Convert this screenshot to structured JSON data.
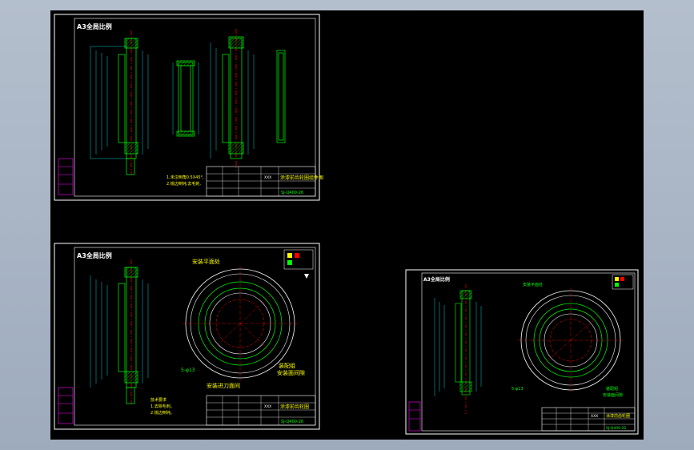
{
  "colors": {
    "background": "#000000",
    "frame": "#ffffff",
    "geometry": "#00ff00",
    "dimension": "#00ffff",
    "centerline": "#ff0000",
    "text": "#ffff00",
    "magenta": "#ff00ff"
  },
  "sheets": [
    {
      "title": "A3全局比例",
      "notes": [
        "1.未注倒角0.5X45°,",
        "2.锐边倒钝,去毛刺,"
      ],
      "title_block": {
        "name": "涂漆前齿轮圈组件图",
        "code": "SJ-Q400-26",
        "label": "XXX"
      }
    },
    {
      "title": "A3全局比例",
      "annotations": [
        "安装平面处",
        "5-φ13",
        "安装进刀面间",
        "装配组",
        "安装面间隙"
      ],
      "notes": [
        "技术要求",
        "1.去除毛刺。",
        "2.锐边倒钝。"
      ],
      "title_block": {
        "name": "涂漆前齿轮圈",
        "code": "SJ-Q400-26",
        "label": "XXX"
      }
    },
    {
      "title": "A3全局比例",
      "annotations": [
        "安装平面处",
        "5-φ13",
        "装配组",
        "安装面间隙"
      ],
      "title_block": {
        "name": "涂漆前齿轮圈",
        "code": "SJ-Q400-25",
        "label": "XXX"
      }
    }
  ]
}
